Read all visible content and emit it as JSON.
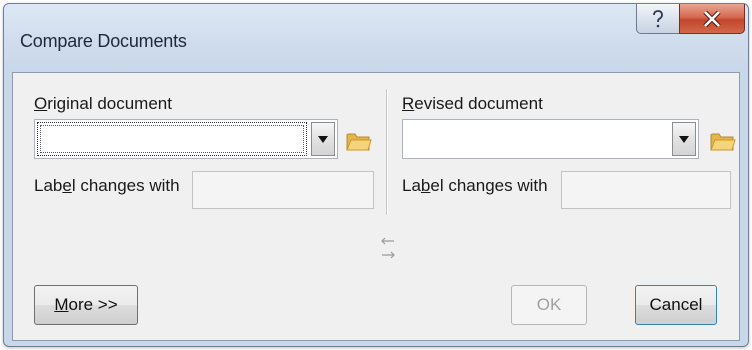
{
  "window": {
    "title": "Compare Documents",
    "help_glyph": "?",
    "close_glyph": "X"
  },
  "original": {
    "label_mnemonic": "O",
    "label_rest": "riginal document",
    "combo_value": "",
    "label_changes_pre": "Lab",
    "label_changes_mnemonic": "e",
    "label_changes_post": "l changes with",
    "label_changes_value": ""
  },
  "revised": {
    "label_mnemonic": "R",
    "label_rest": "evised document",
    "combo_value": "",
    "label_changes_pre": "La",
    "label_changes_mnemonic": "b",
    "label_changes_post": "el changes with",
    "label_changes_value": ""
  },
  "buttons": {
    "more_mnemonic": "M",
    "more_rest": "ore >>",
    "ok": "OK",
    "cancel": "Cancel"
  },
  "colors": {
    "close_button": "#c2452c",
    "folder_icon": "#e8b548"
  }
}
